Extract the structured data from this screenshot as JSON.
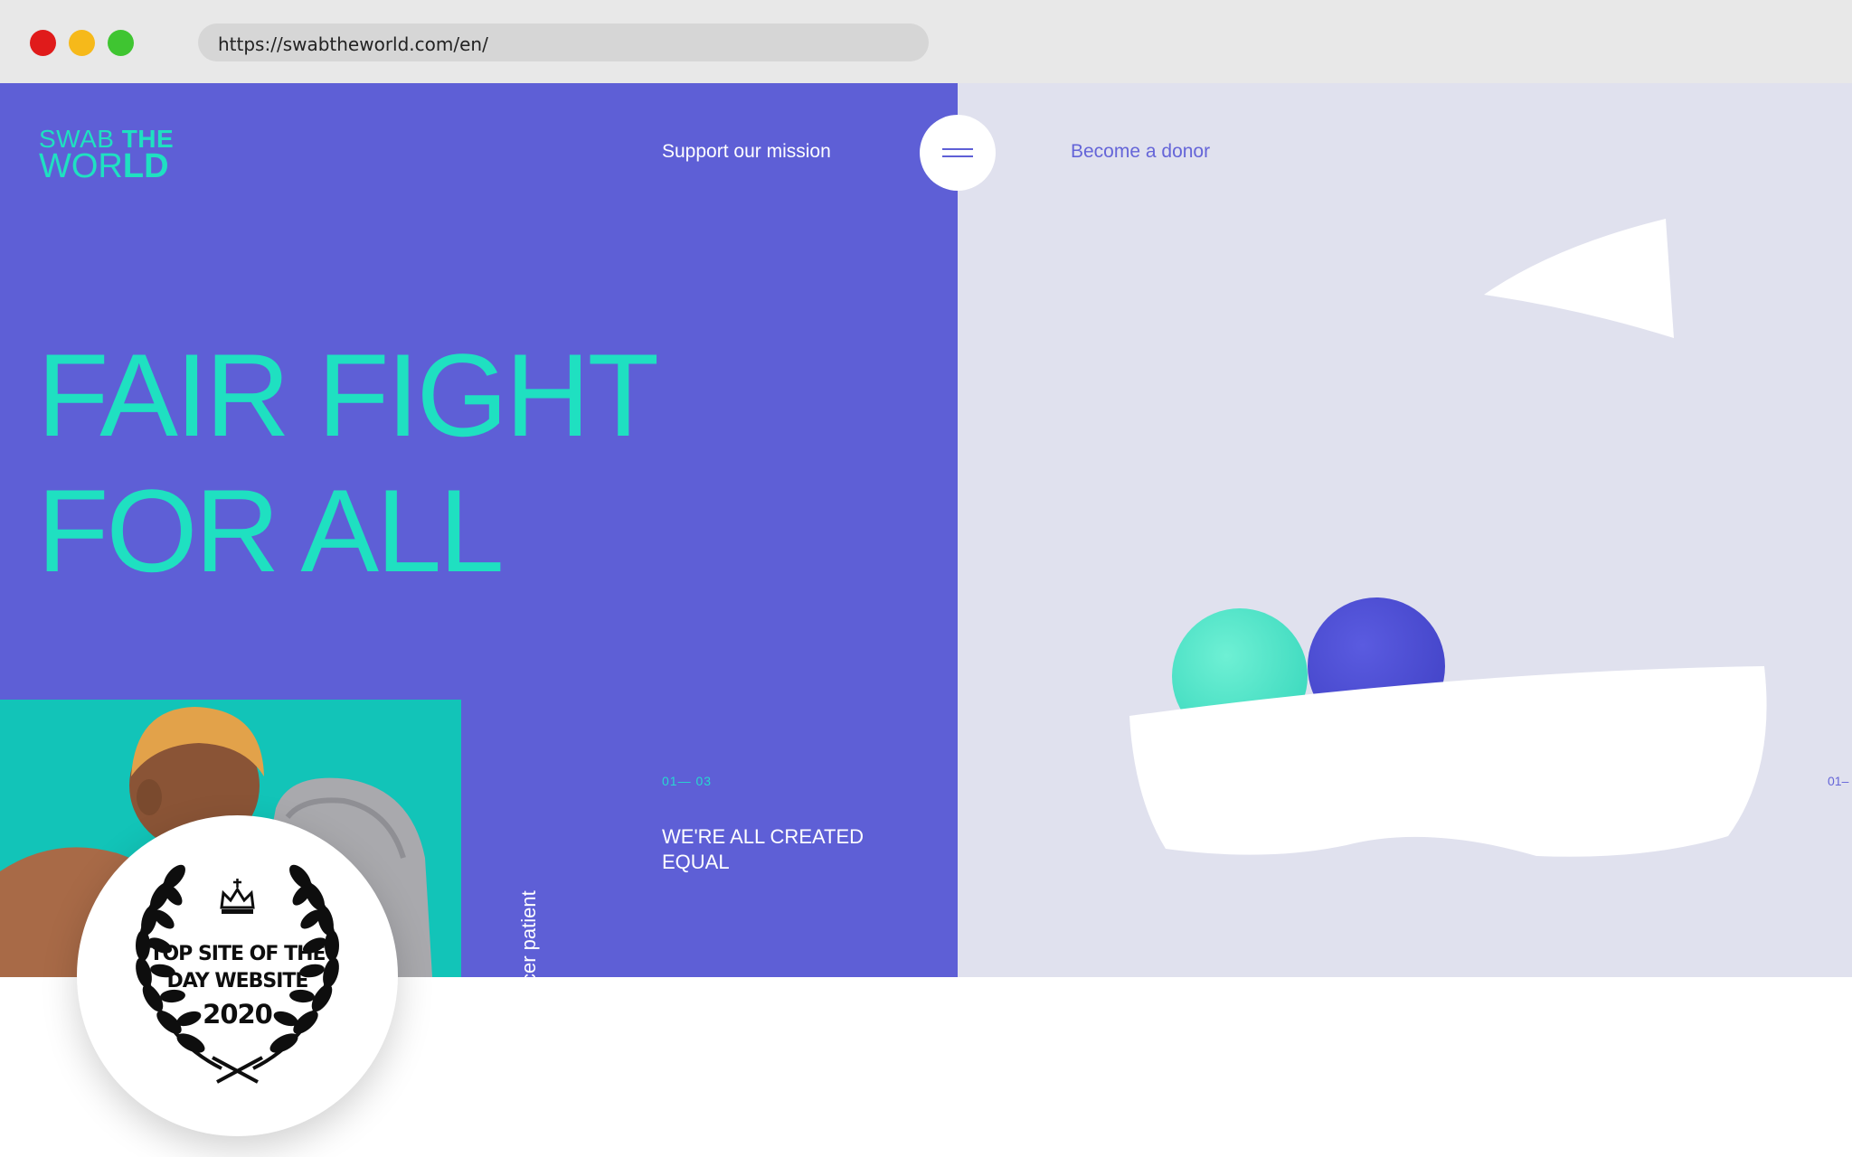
{
  "browser": {
    "url": "https://swabtheworld.com/en/"
  },
  "header": {
    "logo_line1_a": "SWAB",
    "logo_line1_b": "THE",
    "logo_line2_a": "WOR",
    "logo_line2_b": "LD",
    "support_label": "Support our mission",
    "donor_label": "Become a donor"
  },
  "hero": {
    "title_line1": "FAIR FIGHT",
    "title_line2": "FOR ALL"
  },
  "slider": {
    "counter": "01— 03",
    "counter_right": "01–",
    "slide_title": "WE'RE ALL CREATED EQUAL",
    "vertical_caption": "cer patient"
  },
  "award": {
    "line1": "TOP SITE OF THE",
    "line2": "DAY WEBSITE",
    "year": "2020"
  },
  "colors": {
    "primary_purple": "#5e5fd6",
    "accent_teal": "#1fe0c1",
    "right_panel_bg": "#e0e1ee"
  },
  "icons": {
    "menu": "hamburger-icon",
    "award": "laurel-wreath-icon"
  }
}
